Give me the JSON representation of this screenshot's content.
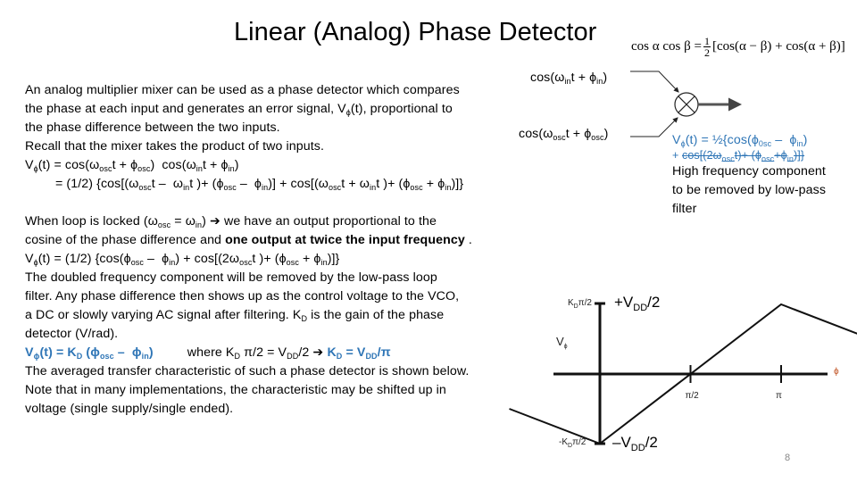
{
  "slide": {
    "title": "Linear (Analog) Phase Detector",
    "page_number": "8",
    "accent_color": "#2e75b6"
  },
  "identity": {
    "lhs": "cos α cos β = ",
    "frac_num": "1",
    "frac_den": "2",
    "rhs": "[cos(α − β) + cos(α + β)]"
  },
  "intro": {
    "line1": "An analog multiplier mixer can be used as a phase detector which compares",
    "line2a": "the phase at each input and generates an error signal, V",
    "line2_sub": "ϕ",
    "line2b": "(t), proportional to",
    "line3": "the phase difference between the two inputs.",
    "line4": "Recall that the mixer takes the product of two inputs."
  },
  "eq1": {
    "a": "V",
    "a_sub": "ϕ",
    "b": "(t) = cos(ω",
    "b_sub": "osc",
    "c": "t + ϕ",
    "c_sub": "osc",
    "d": ")  cos(ω",
    "d_sub": "in",
    "e": "t + ϕ",
    "e_sub": "in",
    "f": ")"
  },
  "eq2": {
    "a": "= (1/2) {cos[(ω",
    "a_sub": "osc",
    "b": "t –  ω",
    "b_sub": "in",
    "c": "t )+ (ϕ",
    "c_sub": "osc",
    "d": " –  ϕ",
    "d_sub": "in",
    "e": ")] + cos[(ω",
    "e_sub": "osc",
    "f": "t + ω",
    "f_sub": "in",
    "g": "t )+ (ϕ",
    "g_sub": "osc",
    "h": " + ϕ",
    "h_sub": "in",
    "i": ")]}"
  },
  "locked": {
    "l1a": "When loop is locked (ω",
    "l1a_sub": "osc",
    "l1b": " = ω",
    "l1b_sub": "in",
    "l1c": ") ",
    "arrow": "➔",
    "l1d": " we have an output proportional to the",
    "l2a": "cosine of the phase difference and ",
    "l2b_bold": "one output at twice the input frequency",
    "l2c": " .",
    "l3a": "V",
    "l3a_sub": "ϕ",
    "l3b": "(t) = (1/2) {cos(ϕ",
    "l3b_sub": "osc",
    "l3c": " –  ϕ",
    "l3c_sub": "in",
    "l3d": ") + cos[(2ω",
    "l3d_sub": "osc",
    "l3e": "t )+ (ϕ",
    "l3e_sub": "osc",
    "l3f": " + ϕ",
    "l3f_sub": "in",
    "l3g": ")]}",
    "l4": "The doubled frequency component will be removed by the low-pass loop",
    "l5": "filter. Any phase difference then shows up as the control voltage to the VCO,",
    "l6a": "a DC or slowly varying AC signal after filtering. K",
    "l6_sub": "D",
    "l6b": " is the gain of the phase",
    "l7": "detector (V/rad)."
  },
  "kd": {
    "a": "V",
    "a_sub": "ϕ",
    "b": "(t) = K",
    "b_sub": "D",
    "c": " (ϕ",
    "c_sub": "osc",
    "d": " –  ϕ",
    "d_sub": "in",
    "e": ")",
    "where": "where  K",
    "where_sub": "D",
    "where2": " π/2 = V",
    "where2_sub": "DD",
    "where3": "/2 ",
    "arrow": "➔",
    "res_a": " K",
    "res_sub": "D",
    "res_b": " = V",
    "res_sub2": "DD",
    "res_c": "/π"
  },
  "averaged": {
    "l1": "The averaged transfer characteristic of such a phase detector is shown below.",
    "l2": "Note that in many implementations, the characteristic may be shifted up in",
    "l3": "voltage (single supply/single ended)."
  },
  "mixer": {
    "in_a": "cos(ω",
    "in_sub": "in",
    "in_b": "t + ϕ",
    "in_sub2": "in",
    "in_c": ")",
    "osc_a": "cos(ω",
    "osc_sub": "osc",
    "osc_b": "t + ϕ",
    "osc_sub2": "osc",
    "osc_c": ")",
    "icon": "multiplier-circle-x"
  },
  "annotation": {
    "l1a": "V",
    "l1_sub": "ϕ",
    "l1b": "(t) = ½{cos(ϕ",
    "l1_sub2": "0sc",
    "l1c": " –  ϕ",
    "l1_sub3": "in",
    "l1d": ")",
    "l2_plus": "+ ",
    "l2a": "cos[(2ω",
    "l2_sub": "osc",
    "l2b": "t)+ (ϕ",
    "l2_sub2": "osc",
    "l2c": "+ϕ",
    "l2_sub3": "in",
    "l2d": ")]}",
    "l3": "High frequency component",
    "l4": "to be removed by low-pass",
    "l5": "filter"
  },
  "transfer_graph": {
    "y_axis_label": "V",
    "y_axis_sub": "ϕ",
    "x_axis_label": "ϕ",
    "top_tick_label": "K",
    "top_tick_sub": "D",
    "top_tick_rest": "π/2",
    "bottom_tick_label": "-K",
    "bottom_tick_sub": "D",
    "bottom_tick_rest": "π/2",
    "top_value_a": "+V",
    "top_value_sub": "DD",
    "top_value_b": "/2",
    "bottom_value_a": "–V",
    "bottom_value_sub": "DD",
    "bottom_value_b": "/2",
    "x_ticks": [
      {
        "label": "π/2",
        "phase_over_pi": 0.5
      },
      {
        "label": "π",
        "phase_over_pi": 1.0
      }
    ],
    "curve_points": [
      {
        "phase_over_pi": -0.5,
        "v_norm": -0.5
      },
      {
        "phase_over_pi": 0.0,
        "v_norm": -1.0
      },
      {
        "phase_over_pi": 1.0,
        "v_norm": 1.0
      },
      {
        "phase_over_pi": 1.5,
        "v_norm": 0.5
      }
    ]
  }
}
